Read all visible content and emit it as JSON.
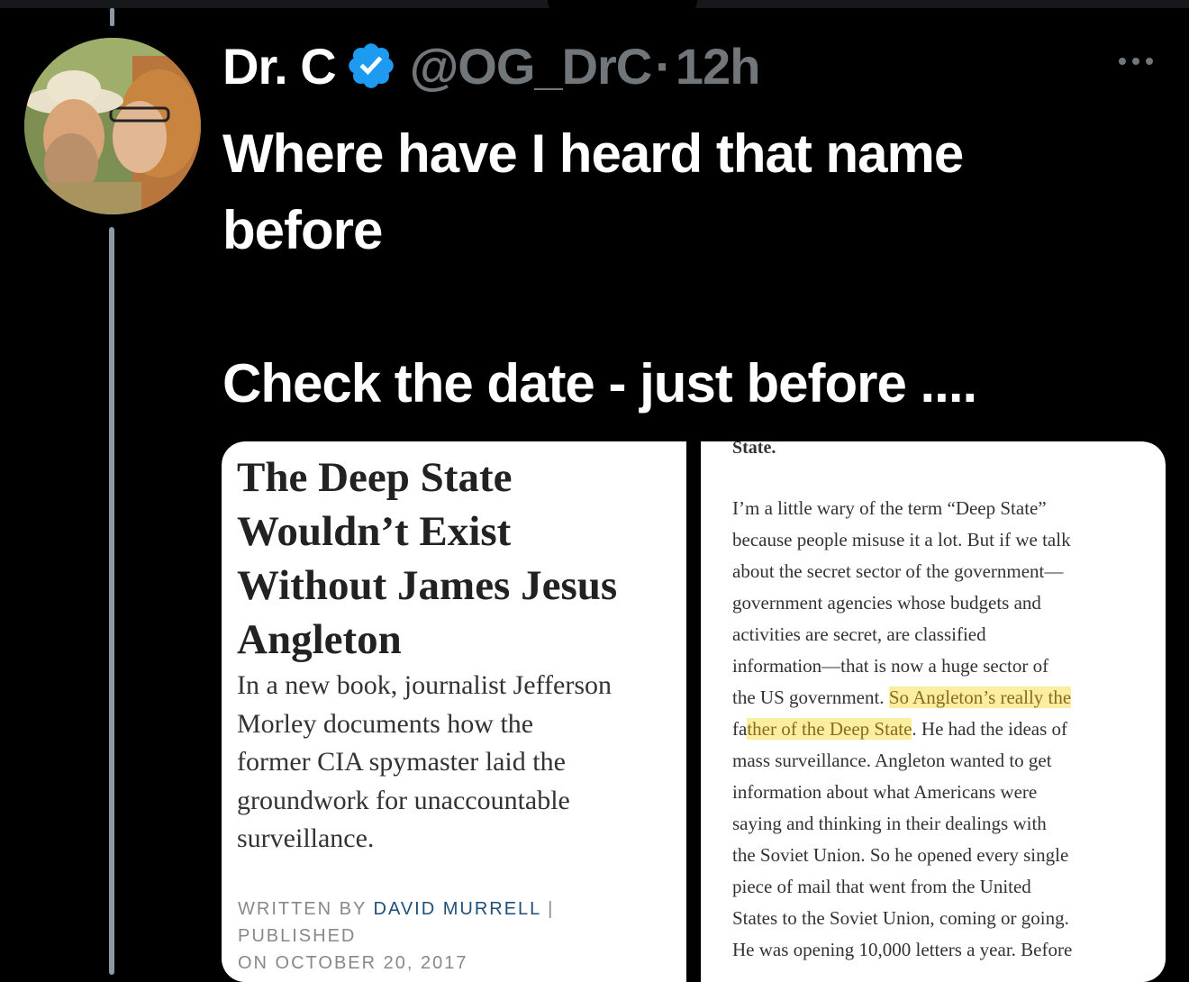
{
  "tweet": {
    "display_name": "Dr. C",
    "handle": "@OG_DrC",
    "separator": "·",
    "time": "12h",
    "text_lines": [
      "Where have I heard that name",
      "before",
      "Check the date - just before ...."
    ],
    "verified_color": "#1d9bf0"
  },
  "article": {
    "title_lines": [
      "The Deep State",
      "Wouldn’t Exist",
      "Without James Jesus",
      "Angleton"
    ],
    "subtitle_lines": [
      "In a new book, journalist Jefferson",
      "Morley documents how the",
      "former CIA spymaster laid the",
      "groundwork for unaccountable",
      "surveillance."
    ],
    "byline_prefix": "WRITTEN BY ",
    "author": "DAVID MURRELL",
    "byline_mid": " | PUBLISHED",
    "byline_date": "ON OCTOBER 20, 2017"
  },
  "excerpt": {
    "heading": "State.",
    "lines": [
      "I’m a little wary of the term “Deep State”",
      "because people misuse it a lot. But if we talk",
      "about the secret sector of the government—",
      "government agencies whose budgets and",
      "activities are secret, are classified",
      "information—that is now a huge sector of"
    ],
    "line7_pre": "the US government. ",
    "line7_hl": "So Angleton’s really the",
    "line8_pre": "fa",
    "line8_hl": "ther of the Deep State",
    "line8_post": ". He had the ideas of",
    "lines_after": [
      "mass surveillance. Angleton wanted to get",
      "information about what Americans were",
      "saying and thinking in their dealings with",
      "the Soviet Union. So he opened every single",
      "piece of mail that went from the United",
      "States to the Soviet Union, coming or going.",
      "He was opening 10,000 letters a year. Before"
    ],
    "highlight_color": "#fbeea0"
  }
}
